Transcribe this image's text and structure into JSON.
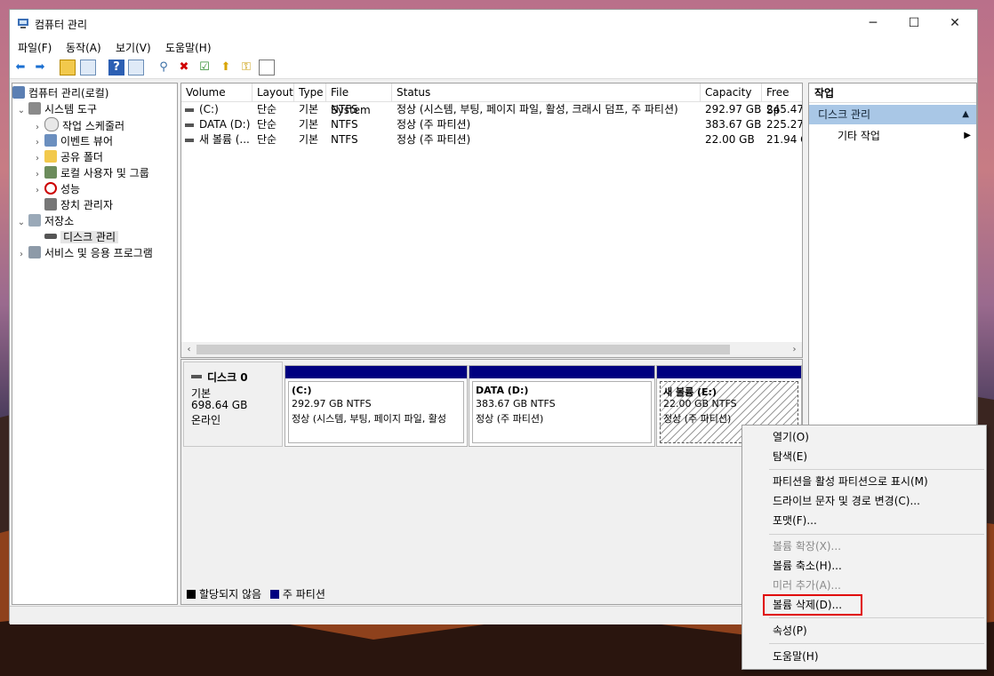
{
  "window": {
    "title": "컴퓨터 관리",
    "minimize": "─",
    "maximize": "☐",
    "close": "✕"
  },
  "menu": [
    "파일(F)",
    "동작(A)",
    "보기(V)",
    "도움말(H)"
  ],
  "tree": {
    "root": "컴퓨터 관리(로컬)",
    "system_tools": "시스템 도구",
    "task_scheduler": "작업 스케줄러",
    "event_viewer": "이벤트 뷰어",
    "shared_folders": "공유 폴더",
    "local_users": "로컬 사용자 및 그룹",
    "performance": "성능",
    "device_manager": "장치 관리자",
    "storage": "저장소",
    "disk_management": "디스크 관리",
    "services_apps": "서비스 및 응용 프로그램"
  },
  "volume_list": {
    "columns": [
      "Volume",
      "Layout",
      "Type",
      "File System",
      "Status",
      "Capacity",
      "Free Sp"
    ],
    "rows": [
      {
        "volume": "(C:)",
        "layout": "단순",
        "type": "기본",
        "fs": "NTFS",
        "status": "정상 (시스템, 부팅, 페이지 파일, 활성, 크래시 덤프, 주 파티션)",
        "capacity": "292.97 GB",
        "free": "245.47"
      },
      {
        "volume": "DATA (D:)",
        "layout": "단순",
        "type": "기본",
        "fs": "NTFS",
        "status": "정상 (주 파티션)",
        "capacity": "383.67 GB",
        "free": "225.27"
      },
      {
        "volume": "새 볼륨 (...",
        "layout": "단순",
        "type": "기본",
        "fs": "NTFS",
        "status": "정상 (주 파티션)",
        "capacity": "22.00 GB",
        "free": "21.94 G"
      }
    ]
  },
  "disk": {
    "name": "디스크 0",
    "type": "기본",
    "size": "698.64 GB",
    "state": "온라인",
    "partitions": [
      {
        "name": "(C:)",
        "size": "292.97 GB NTFS",
        "status": "정상 (시스템, 부팅, 페이지 파일, 활성"
      },
      {
        "name": "DATA  (D:)",
        "size": "383.67 GB NTFS",
        "status": "정상 (주 파티션)"
      },
      {
        "name": "새 볼륨  (E:)",
        "size": "22.00 GB NTFS",
        "status": "정상 (주 파티션)"
      }
    ]
  },
  "legend": {
    "unallocated": "할당되지 않음",
    "primary": "주 파티션"
  },
  "actions": {
    "header": "작업",
    "section": "디스크 관리",
    "more": "기타 작업"
  },
  "context_menu": {
    "open": "열기(O)",
    "explore": "탐색(E)",
    "mark_active": "파티션을 활성 파티션으로 표시(M)",
    "change_letter": "드라이브 문자 및 경로 변경(C)...",
    "format": "포맷(F)...",
    "extend": "볼륨 확장(X)...",
    "shrink": "볼륨 축소(H)...",
    "add_mirror": "미러 추가(A)...",
    "delete": "볼륨 삭제(D)...",
    "properties": "속성(P)",
    "help": "도움말(H)"
  },
  "colors": {
    "primary_partition": "#000080",
    "highlight": "#e00000"
  }
}
